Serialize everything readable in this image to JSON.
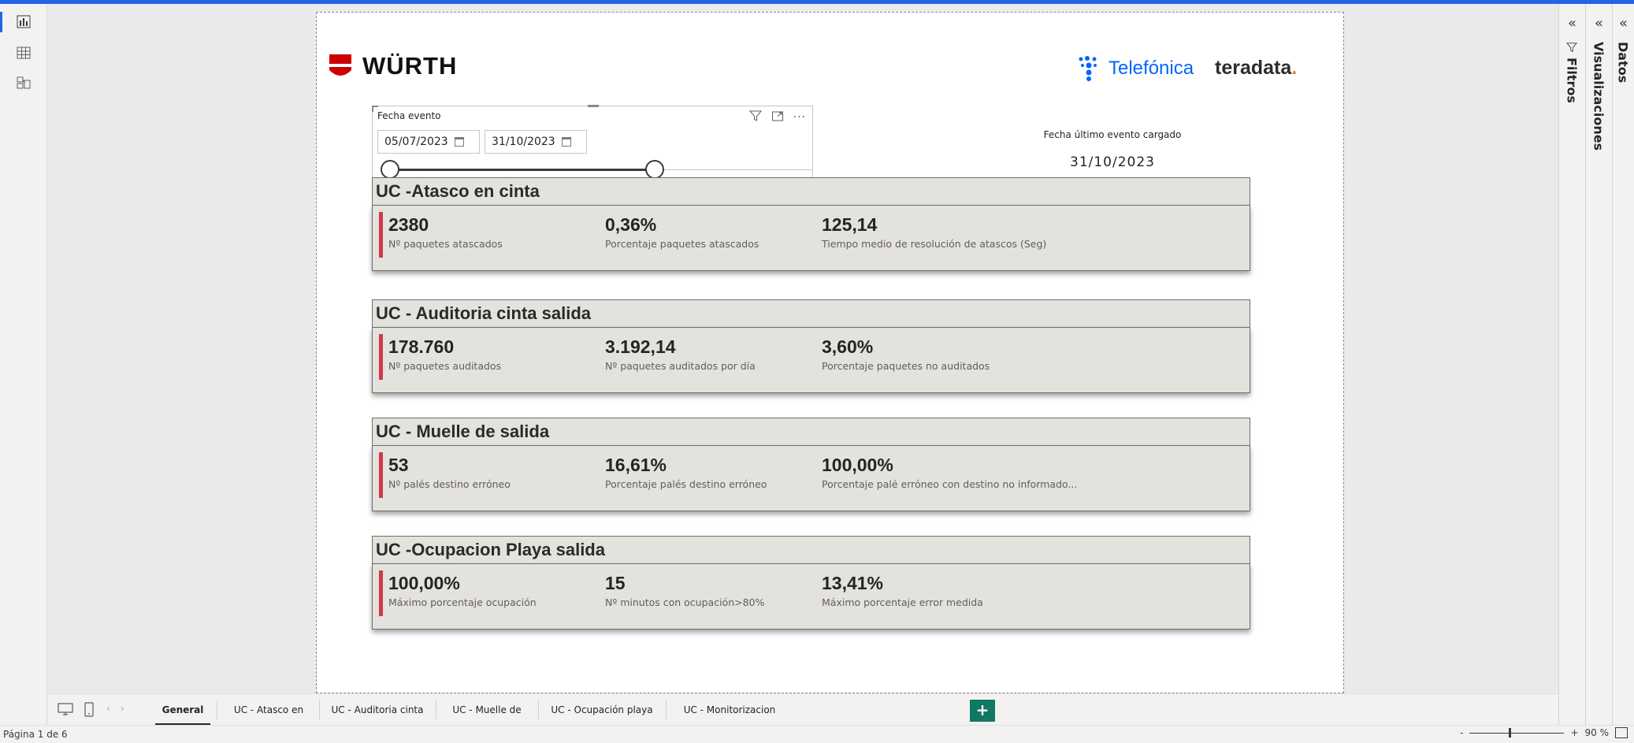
{
  "left_rail": {
    "items": [
      {
        "name": "report-view",
        "icon": "bar-chart-icon"
      },
      {
        "name": "table-view",
        "icon": "table-grid-icon"
      },
      {
        "name": "model-view",
        "icon": "model-icon"
      }
    ]
  },
  "report": {
    "logos": {
      "wurth": "WÜRTH",
      "telefonica": "Telefónica",
      "teradata": "teradata",
      "teradata_dot": "."
    },
    "slicer": {
      "title": "Fecha evento",
      "start_date": "05/07/2023",
      "end_date": "31/10/2023",
      "more": "···"
    },
    "last_event": {
      "label": "Fecha último evento cargado",
      "value": "31/10/2023"
    },
    "sections": [
      {
        "title": "UC -Atasco en cinta",
        "kpis": [
          {
            "value": "2380",
            "label": "Nº paquetes atascados"
          },
          {
            "value": "0,36%",
            "label": "Porcentaje paquetes atascados"
          },
          {
            "value": "125,14",
            "label": "Tiempo medio de resolución de atascos (Seg)"
          }
        ]
      },
      {
        "title": "UC - Auditoria cinta salida",
        "kpis": [
          {
            "value": "178.760",
            "label": "Nº paquetes auditados"
          },
          {
            "value": "3.192,14",
            "label": "Nº paquetes auditados por día"
          },
          {
            "value": "3,60%",
            "label": "Porcentaje paquetes no auditados"
          }
        ]
      },
      {
        "title": "UC - Muelle de salida",
        "kpis": [
          {
            "value": "53",
            "label": "Nº palés destino erróneo"
          },
          {
            "value": "16,61%",
            "label": "Porcentaje palés destino erróneo"
          },
          {
            "value": "100,00%",
            "label": "Porcentaje palé erróneo con destino no informado..."
          }
        ]
      },
      {
        "title": "UC -Ocupacion Playa salida",
        "kpis": [
          {
            "value": "100,00%",
            "label": "Máximo porcentaje ocupación"
          },
          {
            "value": "15",
            "label": "Nº minutos con ocupación>80%"
          },
          {
            "value": "13,41%",
            "label": "Máximo porcentaje error medida"
          }
        ]
      }
    ]
  },
  "panes": {
    "filters": "Filtros",
    "visualizations": "Visualizaciones",
    "data": "Datos",
    "collapse": "«"
  },
  "tabs": {
    "items": [
      {
        "label": "General",
        "active": true
      },
      {
        "label": "UC - Atasco en cinta",
        "active": false
      },
      {
        "label": "UC - Auditoria cinta salida",
        "active": false
      },
      {
        "label": "UC - Muelle de salidas",
        "active": false
      },
      {
        "label": "UC - Ocupación playa salida",
        "active": false
      },
      {
        "label": "UC - Monitorizacion camaras",
        "active": false
      }
    ],
    "add": "+",
    "prev": "‹",
    "next": "›"
  },
  "status": {
    "page": "Página 1 de 6",
    "zoom_minus": "-",
    "zoom_plus": "+",
    "zoom_level": "90 %"
  },
  "colors": {
    "accent": "#d13a4a",
    "brand_blue": "#2266e3",
    "add_tab": "#117865"
  }
}
